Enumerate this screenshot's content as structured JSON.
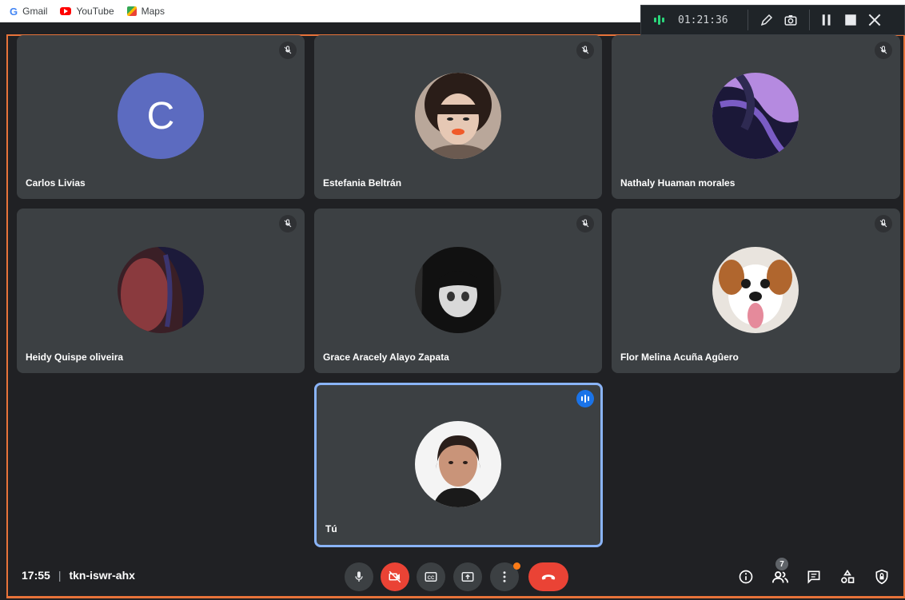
{
  "bookmarks": [
    {
      "label": "Gmail",
      "icon": "google-g-icon"
    },
    {
      "label": "YouTube",
      "icon": "youtube-icon"
    },
    {
      "label": "Maps",
      "icon": "maps-icon"
    }
  ],
  "recorder": {
    "time": "01:21:36",
    "icons": [
      "recording-wave-icon",
      "pencil-icon",
      "camera-icon",
      "pause-icon",
      "stop-icon",
      "close-icon"
    ]
  },
  "participants": [
    {
      "name": "Carlos Livias",
      "initial": "C",
      "muted": true
    },
    {
      "name": "Estefania Beltrán",
      "muted": true
    },
    {
      "name": "Nathaly Huaman morales",
      "muted": true
    },
    {
      "name": "Heidy Quispe oliveira",
      "muted": true
    },
    {
      "name": "Grace Aracely Alayo Zapata",
      "muted": true
    },
    {
      "name": "Flor Melina Acuña Agûero",
      "muted": true
    },
    {
      "name": "Tú",
      "muted": false,
      "speaking": true
    }
  ],
  "meeting": {
    "time": "17:55",
    "separator": "|",
    "code": "tkn-iswr-ahx"
  },
  "controls": [
    "mic-icon",
    "camera-off-icon",
    "captions-icon",
    "present-icon",
    "more-options-icon",
    "hang-up-icon"
  ],
  "right_controls": {
    "people_count": "7",
    "icons": [
      "info-icon",
      "people-icon",
      "chat-icon",
      "activities-icon",
      "host-controls-icon"
    ]
  },
  "colors": {
    "background": "#202124",
    "tile": "#3c4043",
    "frame": "#e8733a",
    "active_border": "#8ab4f8",
    "hang_up": "#ea4335",
    "avatar_letter_bg": "#5c6bc0"
  }
}
